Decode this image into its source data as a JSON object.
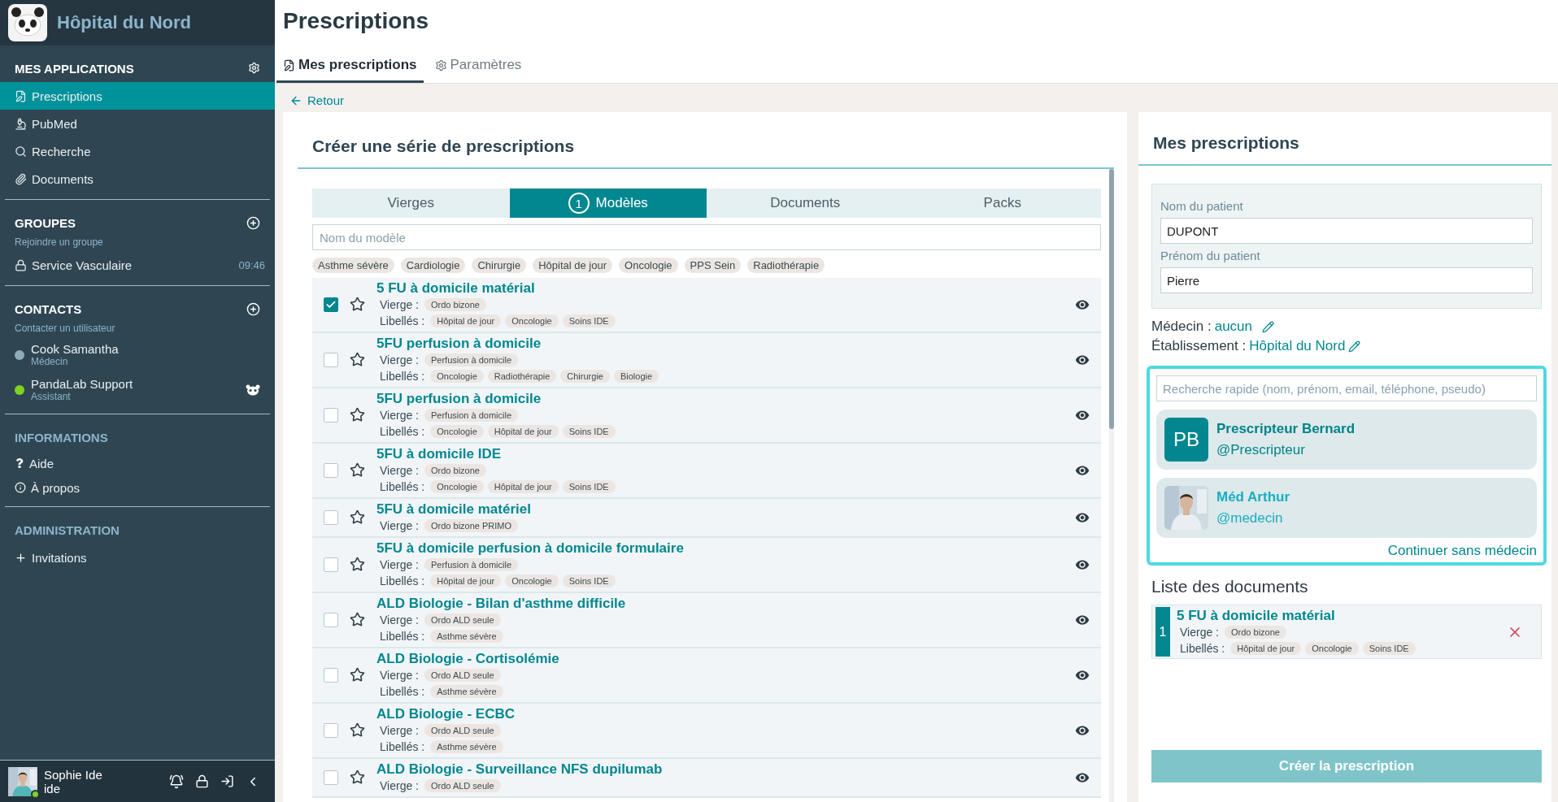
{
  "sidebar": {
    "brand": "Hôpital du Nord",
    "applications": {
      "title": "MES APPLICATIONS",
      "items": [
        {
          "label": "Prescriptions",
          "selected": true
        },
        {
          "label": "PubMed",
          "selected": false
        },
        {
          "label": "Recherche",
          "selected": false
        },
        {
          "label": "Documents",
          "selected": false
        }
      ]
    },
    "groups": {
      "title": "GROUPES",
      "subtitle": "Rejoindre un groupe",
      "items": [
        {
          "label": "Service Vasculaire",
          "time": "09:46"
        }
      ]
    },
    "contacts": {
      "title": "CONTACTS",
      "subtitle": "Contacter un utilisateur",
      "items": [
        {
          "name": "Cook Samantha",
          "role": "Médecin",
          "color": "#8eaabb",
          "assistant": false
        },
        {
          "name": "PandaLab Support",
          "role": "Assistant",
          "color": "#7ed321",
          "assistant": true
        }
      ]
    },
    "informations": {
      "title": "INFORMATIONS",
      "items": [
        "Aide",
        "À propos"
      ]
    },
    "administration": {
      "title": "ADMINISTRATION",
      "items": [
        "Invitations"
      ]
    },
    "user": {
      "name": "Sophie Ide",
      "login": "ide",
      "online": true
    }
  },
  "page": {
    "title": "Prescriptions",
    "tabs": [
      {
        "label": "Mes prescriptions",
        "selected": true
      },
      {
        "label": "Paramètres",
        "selected": false
      }
    ],
    "back": "Retour"
  },
  "series": {
    "title": "Créer une série de prescriptions",
    "tabs": [
      {
        "label": "Vierges",
        "selected": false
      },
      {
        "label": "Modèles",
        "selected": true,
        "count": "1"
      },
      {
        "label": "Documents",
        "selected": false
      },
      {
        "label": "Packs",
        "selected": false
      }
    ],
    "search_placeholder": "Nom du modèle",
    "filters": [
      "Asthme sévère",
      "Cardiologie",
      "Chirurgie",
      "Hôpital de jour",
      "Oncologie",
      "PPS Sein",
      "Radiothérapie"
    ],
    "models": [
      {
        "title": "5 FU à domicile matérial",
        "checked": true,
        "starred": false,
        "vierge_label": "Vierge :",
        "vierge": [
          "Ordo bizone"
        ],
        "libelles_label": "Libellés :",
        "libelles": [
          "Hôpital de jour",
          "Oncologie",
          "Soins IDE"
        ]
      },
      {
        "title": "5FU perfusion à domicile",
        "checked": false,
        "starred": false,
        "vierge_label": "Vierge :",
        "vierge": [
          "Perfusion à domicile"
        ],
        "libelles_label": "Libellés :",
        "libelles": [
          "Oncologie",
          "Radiothérapie",
          "Chirurgie",
          "Biologie"
        ]
      },
      {
        "title": "5FU perfusion à domicile",
        "checked": false,
        "starred": false,
        "vierge_label": "Vierge :",
        "vierge": [
          "Perfusion à domicile"
        ],
        "libelles_label": "Libellés :",
        "libelles": [
          "Oncologie",
          "Hôpital de jour",
          "Soins IDE"
        ]
      },
      {
        "title": "5FU à domicile IDE",
        "checked": false,
        "starred": false,
        "vierge_label": "Vierge :",
        "vierge": [
          "Ordo bizone"
        ],
        "libelles_label": "Libellés :",
        "libelles": [
          "Oncologie",
          "Hôpital de jour",
          "Soins IDE"
        ]
      },
      {
        "title": "5FU à domicile matériel",
        "checked": false,
        "starred": false,
        "vierge_label": "Vierge :",
        "vierge": [
          "Ordo bizone PRIMO"
        ]
      },
      {
        "title": "5FU à domicile perfusion à domicile formulaire",
        "checked": false,
        "starred": false,
        "vierge_label": "Vierge :",
        "vierge": [
          "Perfusion à domicile"
        ],
        "libelles_label": "Libellés :",
        "libelles": [
          "Hôpital de jour",
          "Oncologie",
          "Soins IDE"
        ]
      },
      {
        "title": "ALD Biologie - Bilan d'asthme difficile",
        "checked": false,
        "starred": false,
        "vierge_label": "Vierge :",
        "vierge": [
          "Ordo ALD seule"
        ],
        "libelles_label": "Libellés :",
        "libelles": [
          "Asthme sévère"
        ]
      },
      {
        "title": "ALD Biologie - Cortisolémie",
        "checked": false,
        "starred": false,
        "vierge_label": "Vierge :",
        "vierge": [
          "Ordo ALD seule"
        ],
        "libelles_label": "Libellés :",
        "libelles": [
          "Asthme sévère"
        ]
      },
      {
        "title": "ALD Biologie - ECBC",
        "checked": false,
        "starred": false,
        "vierge_label": "Vierge :",
        "vierge": [
          "Ordo ALD seule"
        ],
        "libelles_label": "Libellés :",
        "libelles": [
          "Asthme sévère"
        ]
      },
      {
        "title": "ALD Biologie - Surveillance NFS dupilumab",
        "checked": false,
        "starred": false,
        "vierge_label": "Vierge :",
        "vierge": [
          "Ordo ALD seule"
        ]
      }
    ]
  },
  "summary": {
    "title": "Mes prescriptions",
    "patient_fields": [
      {
        "label": "Nom du patient",
        "value": "DUPONT"
      },
      {
        "label": "Prénom du patient",
        "value": "Pierre"
      }
    ],
    "medecin": {
      "label": "Médecin :",
      "value": "aucun"
    },
    "etablissement": {
      "label": "Établissement :",
      "value": "Hôpital du Nord"
    },
    "quick_search_placeholder": "Recherche rapide (nom, prénom, email, téléphone, pseudo)",
    "results": [
      {
        "kind": "initials",
        "initials": "PB",
        "name": "Prescripteur Bernard",
        "handle": "@Prescripteur",
        "selected": false
      },
      {
        "name": "Méd Arthur",
        "handle": "@medecin",
        "selected": true
      }
    ],
    "continue": "Continuer sans médecin",
    "documents_title": "Liste des documents",
    "documents": [
      {
        "index": "1",
        "title": "5 FU à domicile matérial",
        "vierge_label": "Vierge :",
        "vierge": [
          "Ordo bizone"
        ],
        "libelles_label": "Libellés :",
        "libelles": [
          "Hôpital de jour",
          "Oncologie",
          "Soins IDE"
        ]
      }
    ],
    "create_button": {
      "label": "Créer la prescription",
      "disabled": true
    }
  }
}
